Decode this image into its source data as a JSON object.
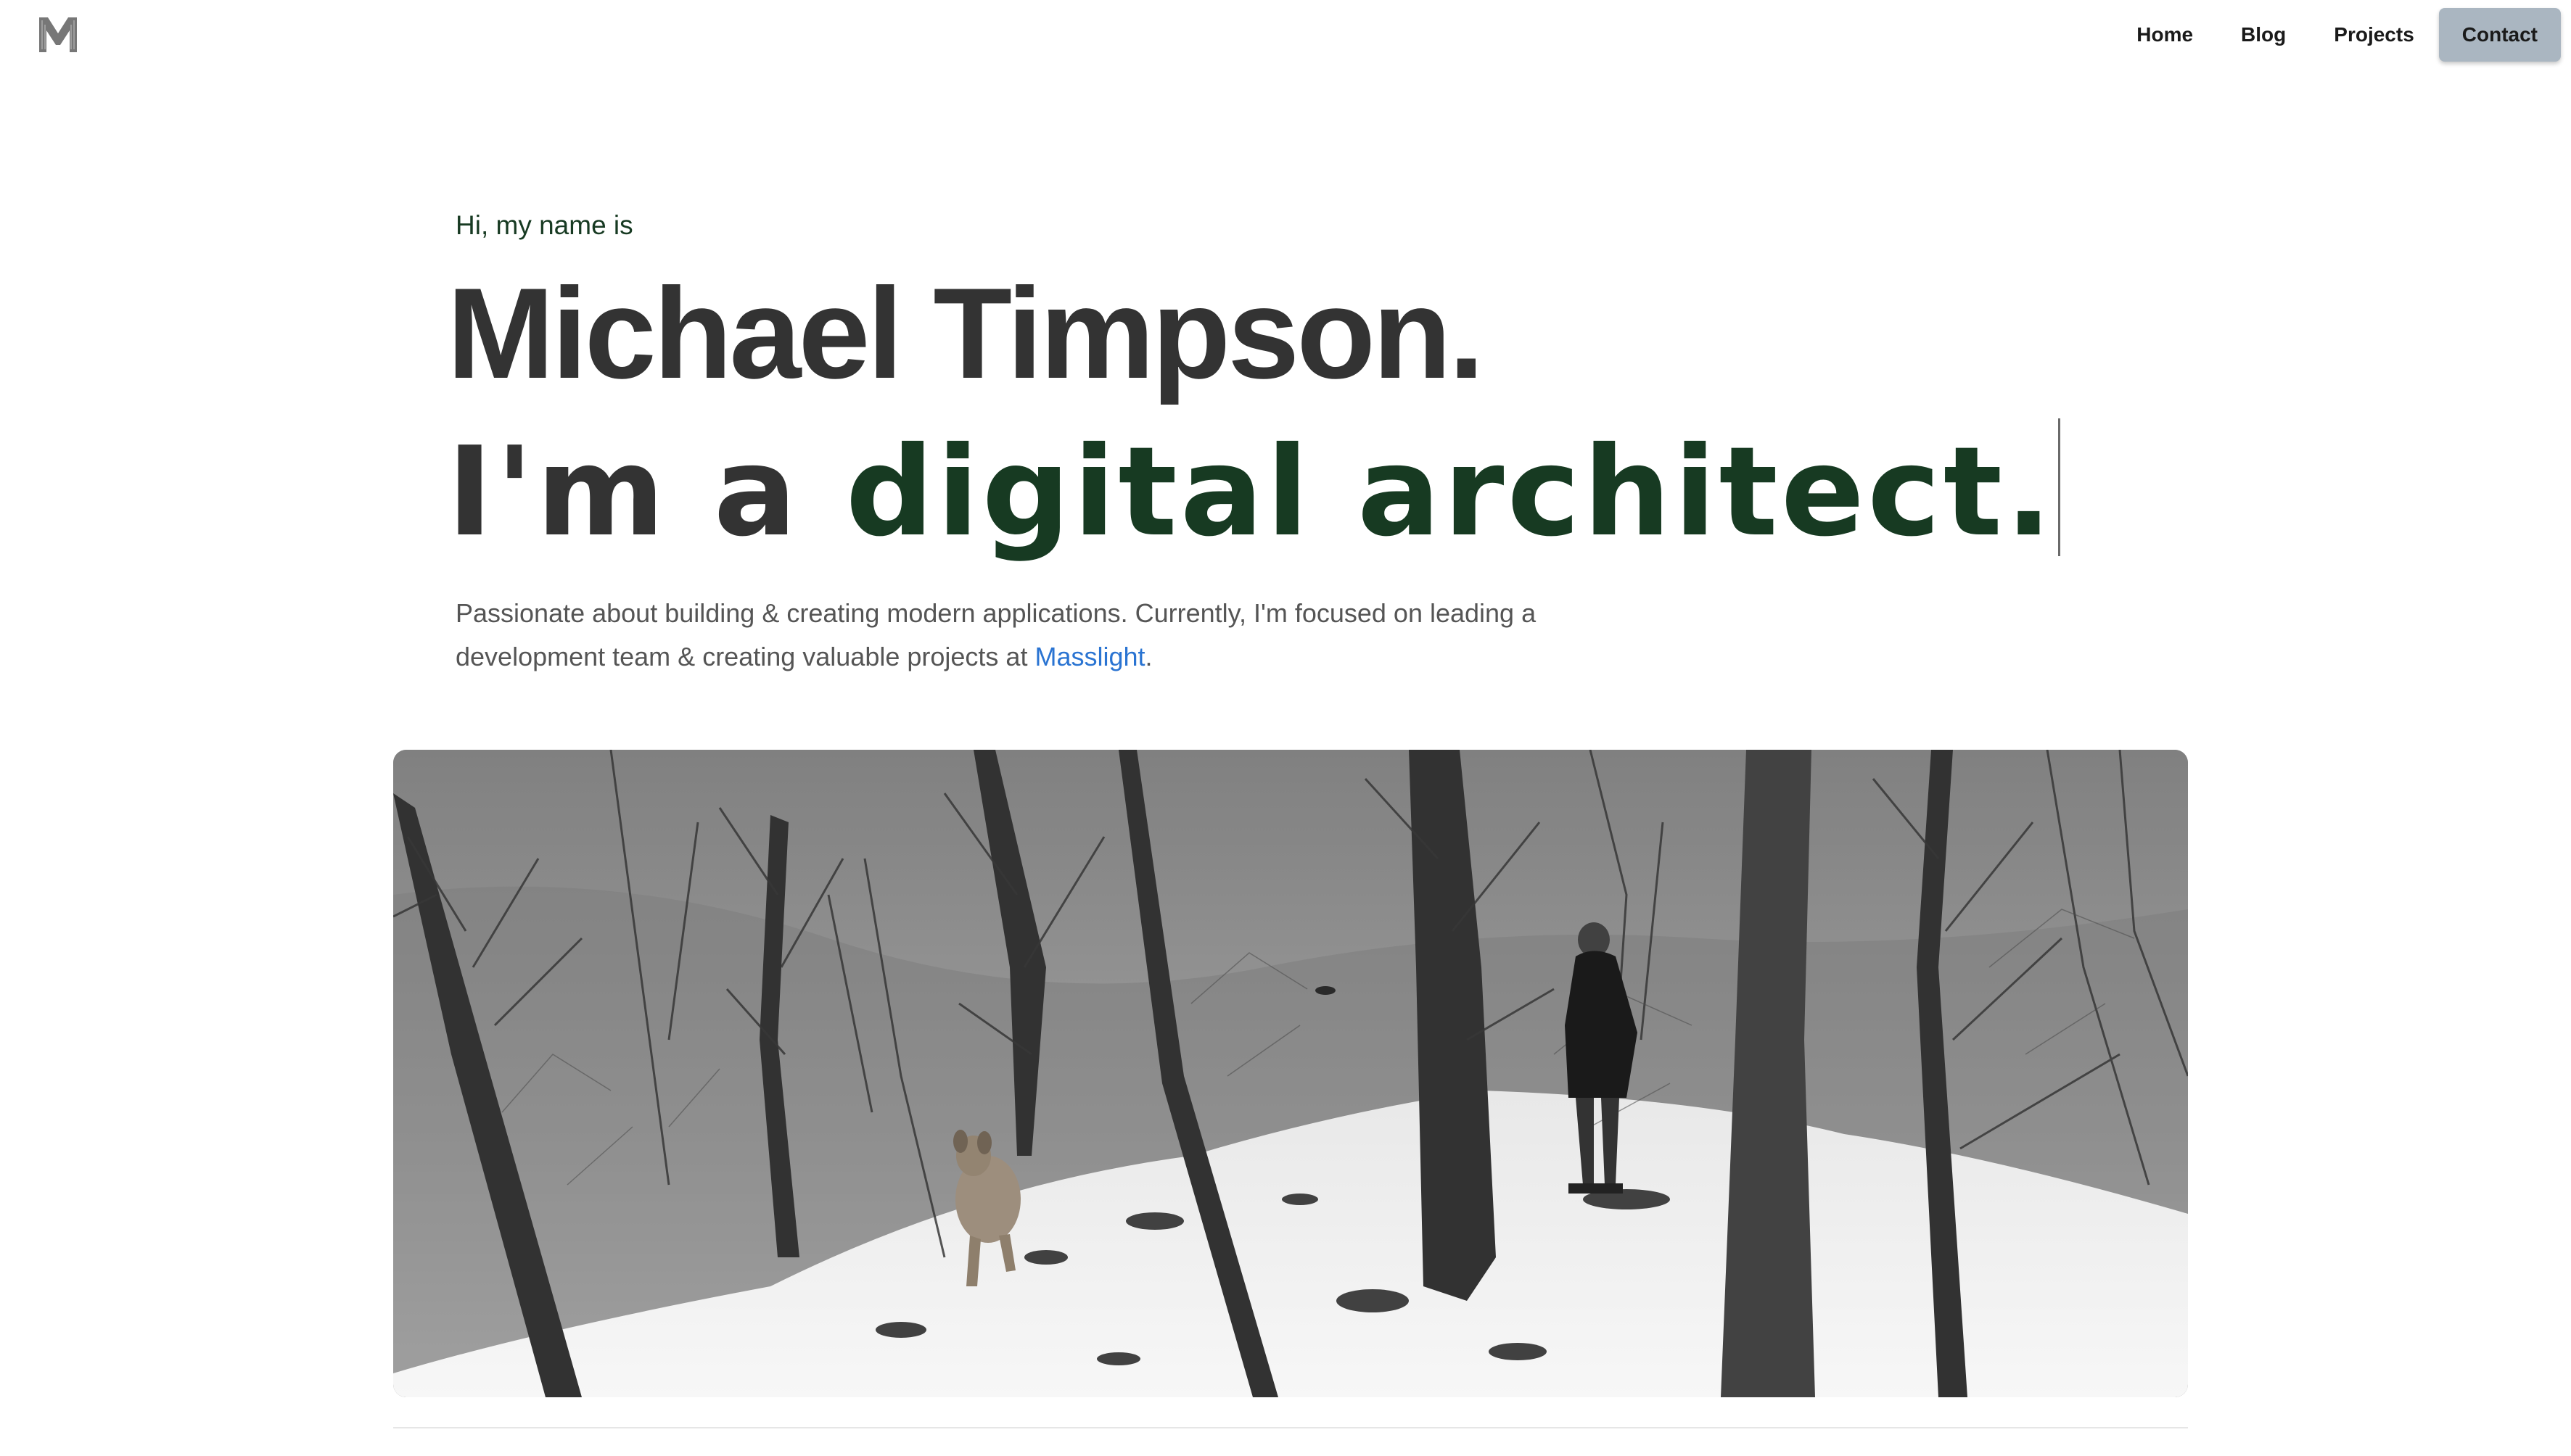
{
  "header": {
    "logo_letter": "M",
    "nav": [
      {
        "label": "Home"
      },
      {
        "label": "Blog"
      },
      {
        "label": "Projects"
      },
      {
        "label": "Contact"
      }
    ]
  },
  "hero": {
    "greeting": "Hi, my name is",
    "name": "Michael Timpson.",
    "tagline_prefix": "I'm a ",
    "tagline_accent": "digital architect.",
    "bio_text": "Passionate about building & creating modern applications. Currently, I'm focused on leading a development team & creating valuable projects at ",
    "bio_link": "Masslight",
    "bio_end": "."
  },
  "colors": {
    "accent_green": "#173a22",
    "link_blue": "#2a74d2",
    "contact_button": "#aab6c1",
    "text_dark": "#333333"
  },
  "icons": {
    "logo": "m-monogram-icon"
  }
}
